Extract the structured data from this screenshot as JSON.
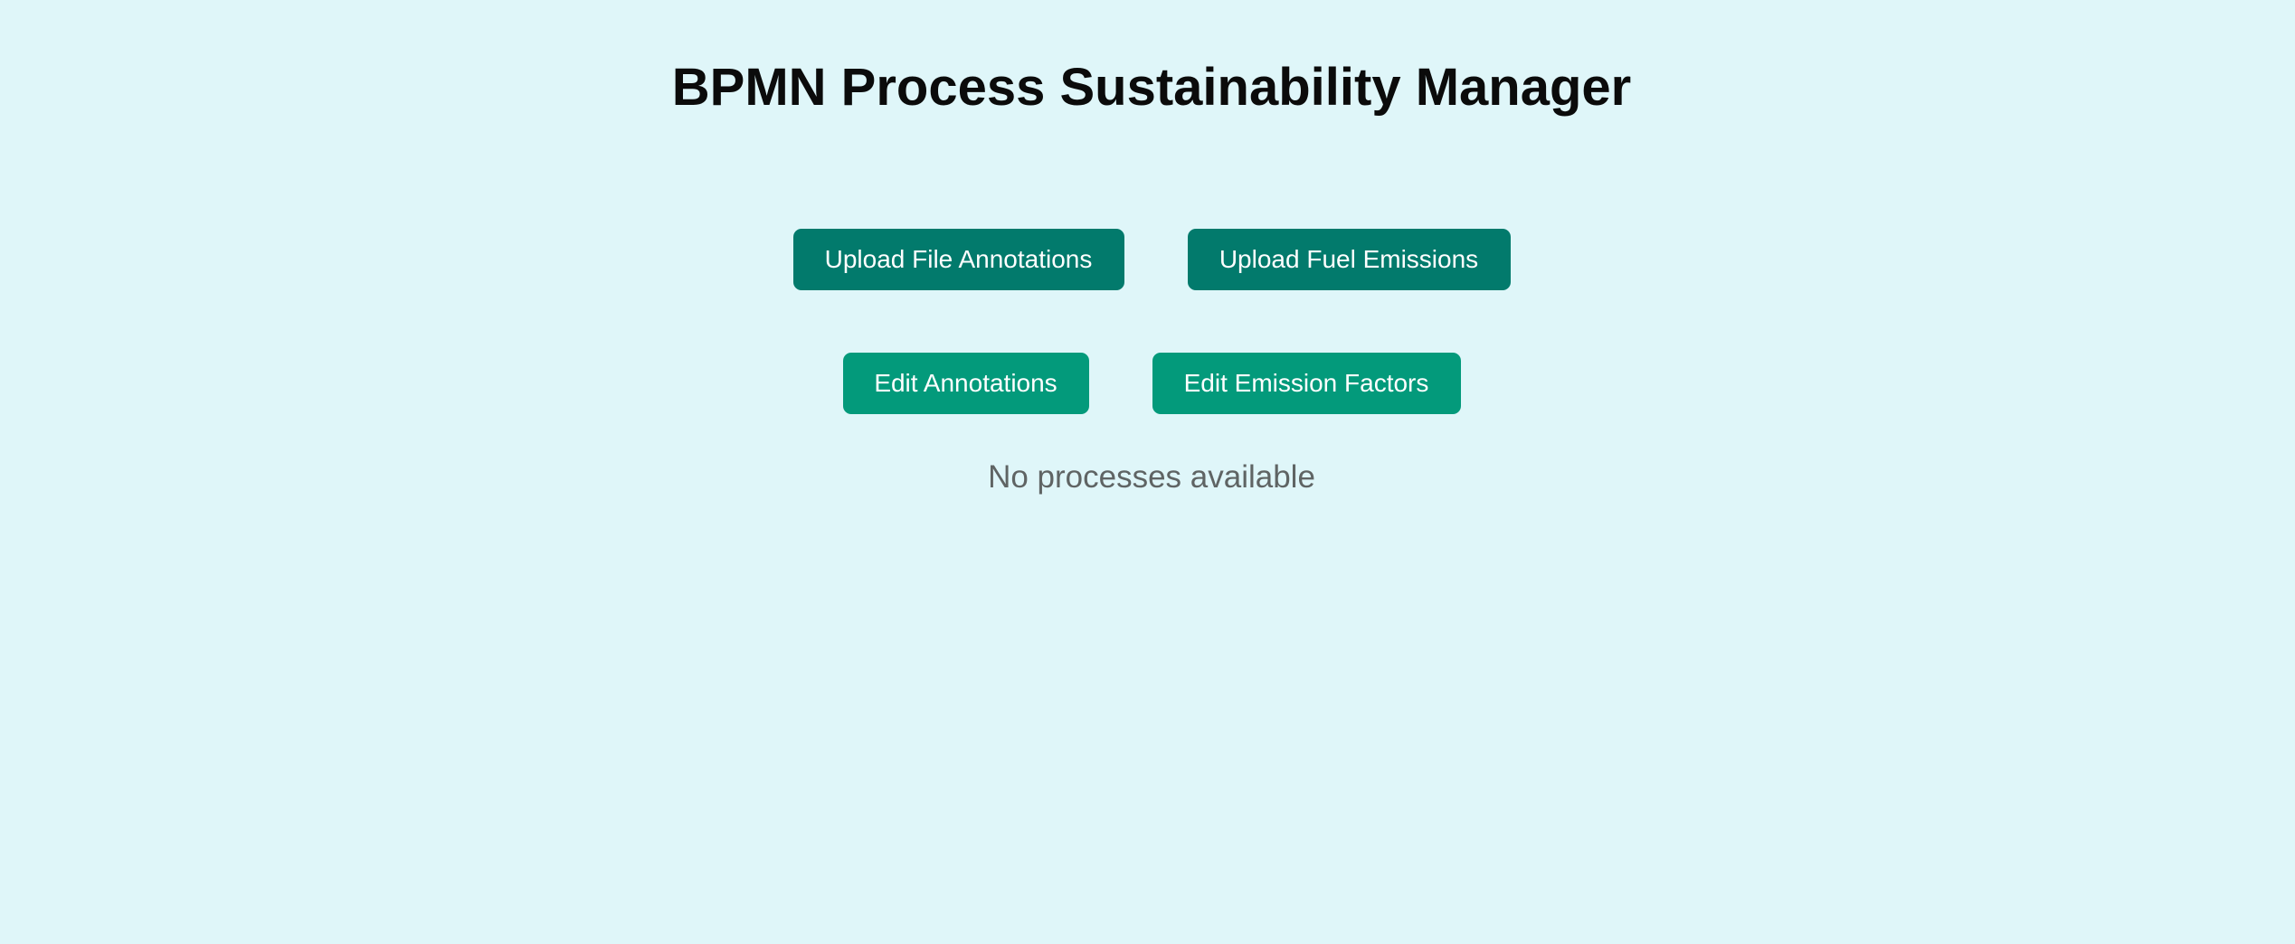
{
  "header": {
    "title": "BPMN Process Sustainability Manager"
  },
  "actions": {
    "upload_file_annotations": "Upload File Annotations",
    "upload_fuel_emissions": "Upload Fuel Emissions",
    "edit_annotations": "Edit Annotations",
    "edit_emission_factors": "Edit Emission Factors"
  },
  "processes": {
    "empty_message": "No processes available"
  },
  "colors": {
    "background": "#dff6f9",
    "upload_button": "#027a6c",
    "edit_button": "#039a7b",
    "muted_text": "#5f6464"
  }
}
